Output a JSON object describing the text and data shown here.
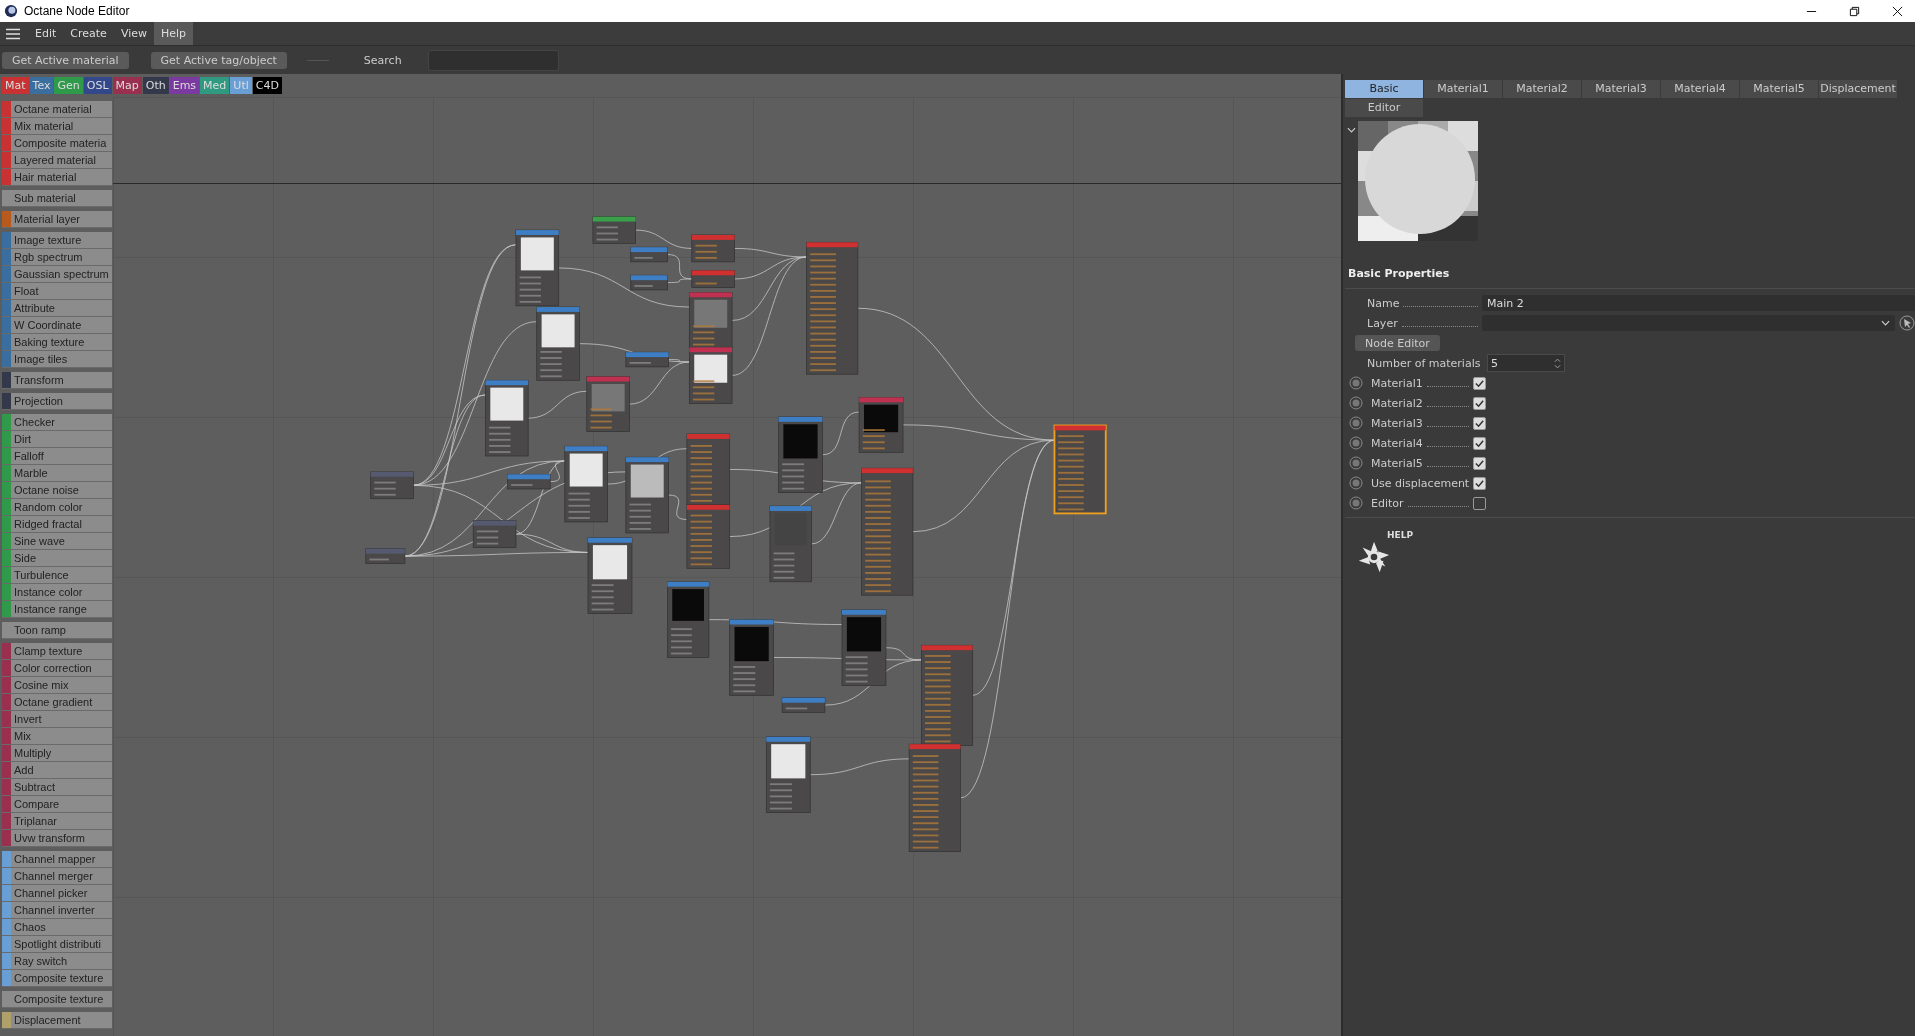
{
  "window": {
    "title": "Octane Node Editor"
  },
  "menu": [
    {
      "label": "Edit",
      "selected": false
    },
    {
      "label": "Create",
      "selected": false
    },
    {
      "label": "View",
      "selected": false
    },
    {
      "label": "Help",
      "selected": true
    }
  ],
  "toolbar": {
    "buttons": [
      "Get Active material",
      "Get Active tag/object"
    ],
    "search_label": "Search"
  },
  "categories": [
    {
      "label": "Mat",
      "color": "#c83232"
    },
    {
      "label": "Tex",
      "color": "#3a6e9e"
    },
    {
      "label": "Gen",
      "color": "#2f9a4a"
    },
    {
      "label": "OSL",
      "color": "#33488a"
    },
    {
      "label": "Map",
      "color": "#9a3050"
    },
    {
      "label": "Oth",
      "color": "#33384a"
    },
    {
      "label": "Ems",
      "color": "#7a3aa0"
    },
    {
      "label": "Med",
      "color": "#2f9a80"
    },
    {
      "label": "Utl",
      "color": "#6a9fd6"
    },
    {
      "label": "C4D",
      "color": "#000000"
    }
  ],
  "palette": [
    {
      "color": "#c83232",
      "items": [
        "Octane material",
        "Mix material",
        "Composite materia",
        "Layered material",
        "Hair material"
      ]
    },
    {
      "items": [
        "Sub material"
      ]
    },
    {
      "color": "#b85a1c",
      "items": [
        "Material layer"
      ]
    },
    {
      "color": "#3a6e9e",
      "items": [
        "Image texture",
        "Rgb spectrum",
        "Gaussian spectrum",
        "Float",
        "Attribute",
        "W Coordinate",
        "Baking texture",
        "Image tiles"
      ]
    },
    {
      "color": "#33384a",
      "items": [
        "Transform"
      ]
    },
    {
      "color": "#33384a",
      "items": [
        "Projection"
      ]
    },
    {
      "color": "#2f9a4a",
      "items": [
        "Checker",
        "Dirt",
        "Falloff",
        "Marble",
        "Octane noise",
        "Random color",
        "Ridged fractal",
        "Sine wave",
        "Side",
        "Turbulence",
        "Instance color",
        "Instance range"
      ]
    },
    {
      "items": [
        "Toon ramp"
      ]
    },
    {
      "color": "#9a3050",
      "items": [
        "Clamp texture",
        "Color correction",
        "Cosine mix",
        "Octane gradient",
        "Invert",
        "Mix",
        "Multiply",
        "Add",
        "Subtract",
        "Compare",
        "Triplanar",
        "Uvw transform"
      ]
    },
    {
      "color": "#6a9fd6",
      "items": [
        "Channel mapper",
        "Channel merger",
        "Channel picker",
        "Channel inverter",
        "Chaos",
        "Spotlight distributi",
        "Ray switch",
        "Composite texture"
      ]
    },
    {
      "items": [
        "Composite texture"
      ]
    },
    {
      "color": "#b0a06a",
      "items": [
        "Displacement"
      ]
    }
  ],
  "tabs": [
    {
      "label": "Basic",
      "selected": true
    },
    {
      "label": "Material1",
      "selected": false
    },
    {
      "label": "Material2",
      "selected": false
    },
    {
      "label": "Material3",
      "selected": false
    },
    {
      "label": "Material4",
      "selected": false
    },
    {
      "label": "Material5",
      "selected": false
    },
    {
      "label": "Displacement",
      "selected": false
    },
    {
      "label": "Editor",
      "selected": false
    }
  ],
  "properties": {
    "title": "Basic Properties",
    "name": {
      "label": "Name",
      "value": "Main 2"
    },
    "layer": {
      "label": "Layer"
    },
    "node_editor_button": "Node Editor",
    "number_of_materials": {
      "label": "Number of materials",
      "value": "5"
    },
    "toggles": [
      {
        "label": "Material1",
        "checked": true
      },
      {
        "label": "Material2",
        "checked": true
      },
      {
        "label": "Material3",
        "checked": true
      },
      {
        "label": "Material4",
        "checked": true
      },
      {
        "label": "Material5",
        "checked": true
      },
      {
        "label": "Use displacement",
        "checked": true
      },
      {
        "label": "Editor",
        "checked": false
      }
    ]
  },
  "help": "HELP"
}
